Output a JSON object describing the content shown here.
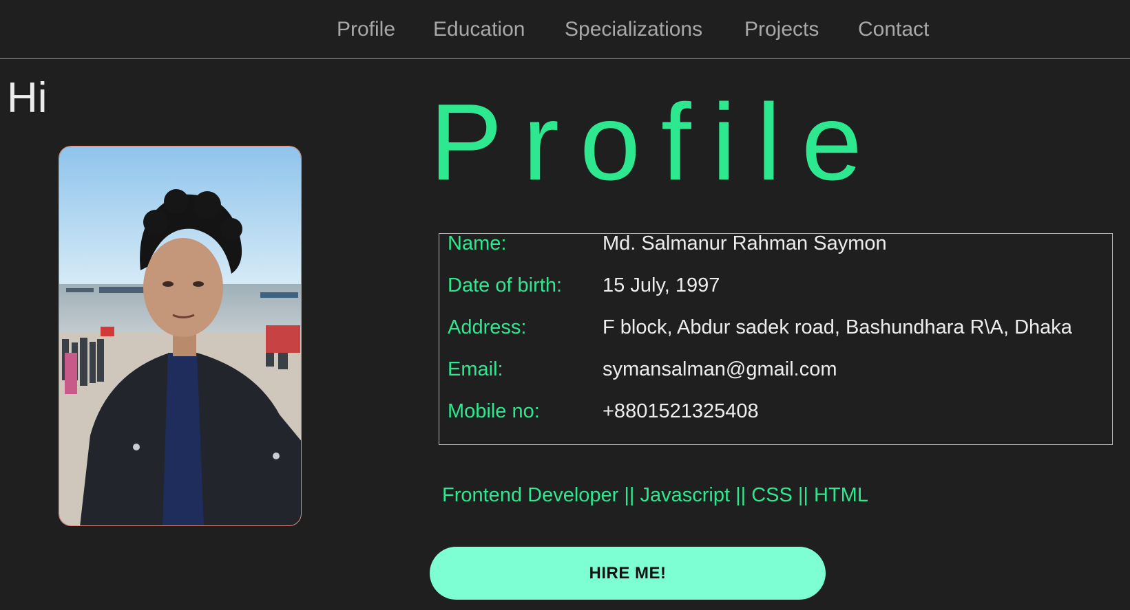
{
  "nav": {
    "items": [
      {
        "label": "Profile"
      },
      {
        "label": "Education"
      },
      {
        "label": "Specializations"
      },
      {
        "label": "Projects"
      },
      {
        "label": "Contact"
      }
    ]
  },
  "intro": {
    "greeting": "Hi"
  },
  "profile": {
    "title": "Profile",
    "fields": [
      {
        "label": "Name:",
        "value": "Md. Salmanur Rahman Saymon"
      },
      {
        "label": "Date of birth:",
        "value": "15 July, 1997"
      },
      {
        "label": "Address:",
        "value": "F block, Abdur sadek road, Bashundhara R\\A, Dhaka"
      },
      {
        "label": "Email:",
        "value": "symansalman@gmail.com"
      },
      {
        "label": "Mobile no:",
        "value": "+8801521325408"
      }
    ],
    "tagline": "Frontend Developer || Javascript || CSS || HTML",
    "hire_label": "HIRE ME!"
  },
  "colors": {
    "background": "#1f1f1f",
    "accent": "#2ee88f",
    "button": "#7dffd3"
  }
}
